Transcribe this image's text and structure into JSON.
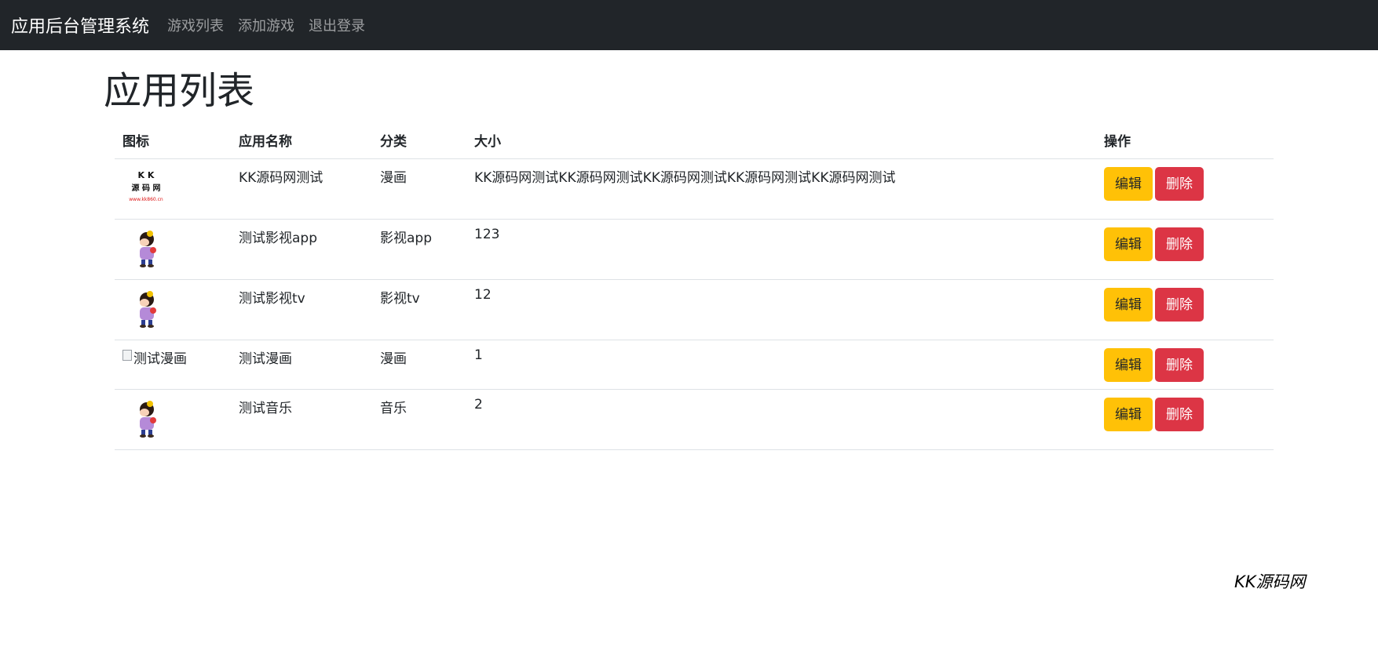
{
  "navbar": {
    "brand": "应用后台管理系统",
    "links": [
      "游戏列表",
      "添加游戏",
      "退出登录"
    ]
  },
  "page": {
    "title": "应用列表"
  },
  "table": {
    "headers": [
      "图标",
      "应用名称",
      "分类",
      "大小",
      "操作"
    ],
    "rows": [
      {
        "icon": "kk-logo-icon",
        "icon_text": "K K 源 码 网",
        "name": "KK源码网测试",
        "category": "漫画",
        "size": "KK源码网测试KK源码网测试KK源码网测试KK源码网测试KK源码网测试"
      },
      {
        "icon": "cartoon-girl-icon",
        "name": "测试影视app",
        "category": "影视app",
        "size": "123"
      },
      {
        "icon": "cartoon-girl-icon",
        "name": "测试影视tv",
        "category": "影视tv",
        "size": "12"
      },
      {
        "icon": "broken-image-icon",
        "icon_alt": "测试漫画",
        "name": "测试漫画",
        "category": "漫画",
        "size": "1"
      },
      {
        "icon": "cartoon-girl-icon",
        "name": "测试音乐",
        "category": "音乐",
        "size": "2"
      }
    ],
    "edit_label": "编辑",
    "delete_label": "删除"
  },
  "footer": {
    "watermark": "KK源码网"
  },
  "colors": {
    "navbar_bg": "#212529",
    "edit": "#ffc107",
    "delete": "#dc3545"
  }
}
